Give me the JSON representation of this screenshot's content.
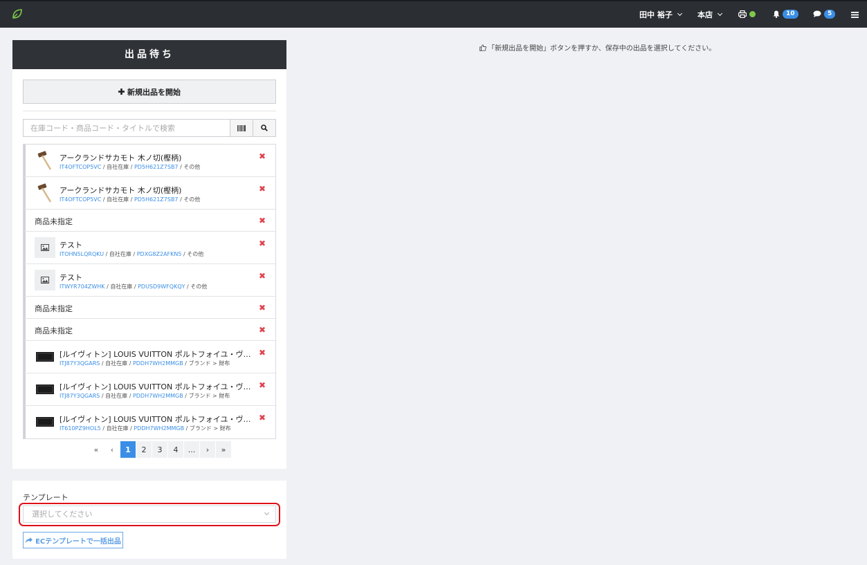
{
  "topbar": {
    "user": "田中 裕子",
    "store": "本店",
    "notifications": "10",
    "messages": "5"
  },
  "hint": {
    "text": "「新規出品を開始」ボタンを押すか、保存中の出品を選択してください。"
  },
  "panel": {
    "title": "出品待ち",
    "new_button": "新規出品を開始",
    "search_placeholder": "在庫コード・商品コード・タイトルで検索"
  },
  "items": [
    {
      "title": "アークランドサカモト 木ノ切(樫柄)",
      "code": "IT4OFTCOP5VC",
      "loc": "自社在庫",
      "pd": "PD5H621Z7SB7",
      "cat": "その他"
    },
    {
      "title": "アークランドサカモト 木ノ切(樫柄)",
      "code": "IT4OFTCOP5VC",
      "loc": "自社在庫",
      "pd": "PD5H621Z7SB7",
      "cat": "その他"
    },
    {
      "plain": "商品未指定"
    },
    {
      "title": "テスト",
      "code": "ITOHN5LQRQKU",
      "loc": "自社在庫",
      "pd": "PDXG8Z2AFKN5",
      "cat": "その他"
    },
    {
      "title": "テスト",
      "code": "ITWYR704ZWHK",
      "loc": "自社在庫",
      "pd": "PDUSD9WFQKQY",
      "cat": "その他"
    },
    {
      "plain": "商品未指定"
    },
    {
      "plain": "商品未指定"
    },
    {
      "title": "[ルイヴィトン] LOUIS VUITTON ポルトフォイユ・ヴィクトリーヌ 三つ折り財布",
      "code": "ITJ87Y3QGARS",
      "loc": "自社在庫",
      "pd": "PDDH7WH2MMGB",
      "cat": "ブランド > 財布"
    },
    {
      "title": "[ルイヴィトン] LOUIS VUITTON ポルトフォイユ・ヴィクトリーヌ 三つ折り財布",
      "code": "ITJ87Y3QGARS",
      "loc": "自社在庫",
      "pd": "PDDH7WH2MMGB",
      "cat": "ブランド > 財布"
    },
    {
      "title": "[ルイヴィトン] LOUIS VUITTON ポルトフォイユ・ヴィクトリーヌ 三つ折り財布",
      "code": "IT610PZ9HOL5",
      "loc": "自社在庫",
      "pd": "PDDH7WH2MMGB",
      "cat": "ブランド > 財布"
    }
  ],
  "pager": {
    "first": "«",
    "prev": "‹",
    "pages": [
      "1",
      "2",
      "3",
      "4"
    ],
    "ellipsis": "...",
    "next": "›",
    "last": "»",
    "current": 1
  },
  "template": {
    "label": "テンプレート",
    "placeholder": "選択してください",
    "ec_button": "ECテンプレートで一括出品"
  },
  "colors": {
    "topbar": "#2b2e33",
    "panel_head": "#2f3237",
    "accent": "#3a8ee6",
    "delete": "#e0424e",
    "highlight": "#e0101a",
    "status_online": "#7ec84b"
  },
  "icons": {
    "logo": "leaf-icon",
    "print": "printer-icon",
    "bell": "bell-icon",
    "chat": "chat-icon",
    "menu": "hamburger-icon",
    "plus": "plus-icon",
    "barcode": "barcode-icon",
    "search": "search-icon",
    "delete": "close-icon",
    "thumbs_up": "thumbs-up-icon",
    "share": "share-icon"
  }
}
